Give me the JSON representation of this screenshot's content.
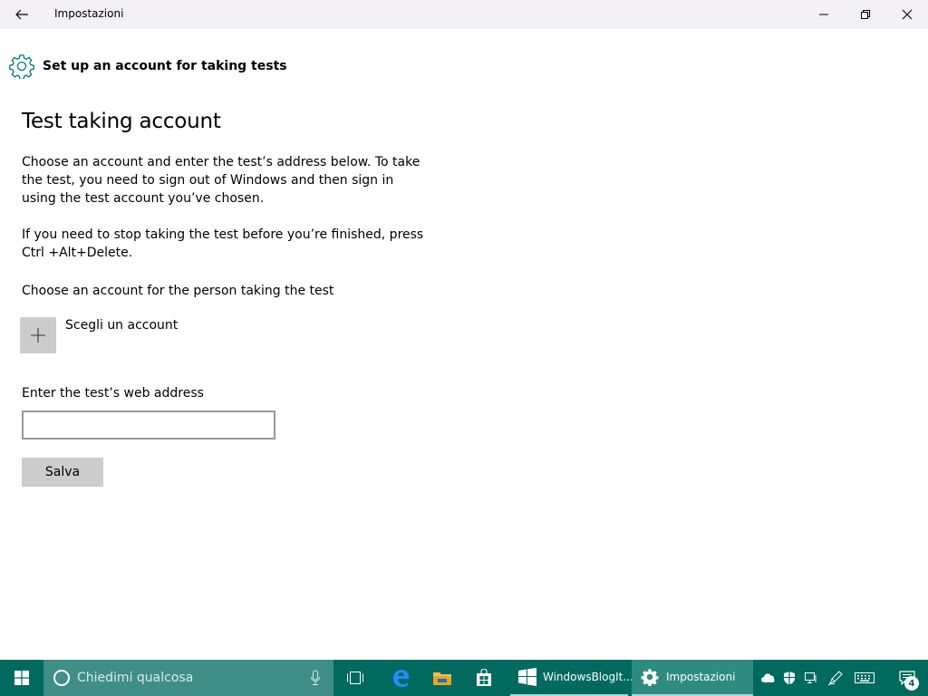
{
  "window": {
    "title": "Impostazioni"
  },
  "header": {
    "title": "Set up an account for taking tests",
    "icon": "gear-icon"
  },
  "main": {
    "section_title": "Test taking account",
    "paragraph1": "Choose an account and enter the test’s address below. To take the test, you need to sign out of Windows and then sign in using the test account you’ve chosen.",
    "paragraph2": "If you need to stop taking the test before you’re finished, press Ctrl +Alt+Delete.",
    "account_label": "Choose an account for the person taking the test",
    "add_account_label": "Scegli un account",
    "url_label": "Enter the test’s web address",
    "url_value": "",
    "save_label": "Salva"
  },
  "taskbar": {
    "search_placeholder": "Chiedimi qualcosa",
    "apps": [
      {
        "label": "WindowsBlogIt...",
        "icon": "blog-icon"
      },
      {
        "label": "Impostazioni",
        "icon": "gear-icon"
      }
    ],
    "notification_count": "4"
  },
  "colors": {
    "accent": "#006a5e",
    "titlebar": "#f4f1f6",
    "button_gray": "#cccccc",
    "header_icon": "#00786b"
  }
}
